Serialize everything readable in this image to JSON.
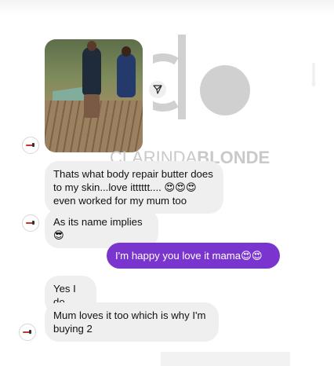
{
  "watermark": {
    "light_text": "CLARINDA",
    "bold_text": "BLONDE"
  },
  "photo_message": {
    "share_icon": "send-paper-plane-icon"
  },
  "messages": [
    {
      "direction": "incoming",
      "text": "Thats what body repair butter does to my skin...love itttttt.... 😍😍😍even worked for my mum too"
    },
    {
      "direction": "incoming",
      "text": "As its name implies 😎"
    },
    {
      "direction": "outgoing",
      "text": "I'm happy you love it mama😍😍"
    },
    {
      "direction": "incoming",
      "text": "Yes I do"
    },
    {
      "direction": "incoming",
      "text": "Mum loves it too which is why I'm buying 2"
    }
  ],
  "colors": {
    "incoming_bubble": "#efefef",
    "outgoing_bubble": "#7b35cf",
    "watermark": "#d0d0d0"
  }
}
